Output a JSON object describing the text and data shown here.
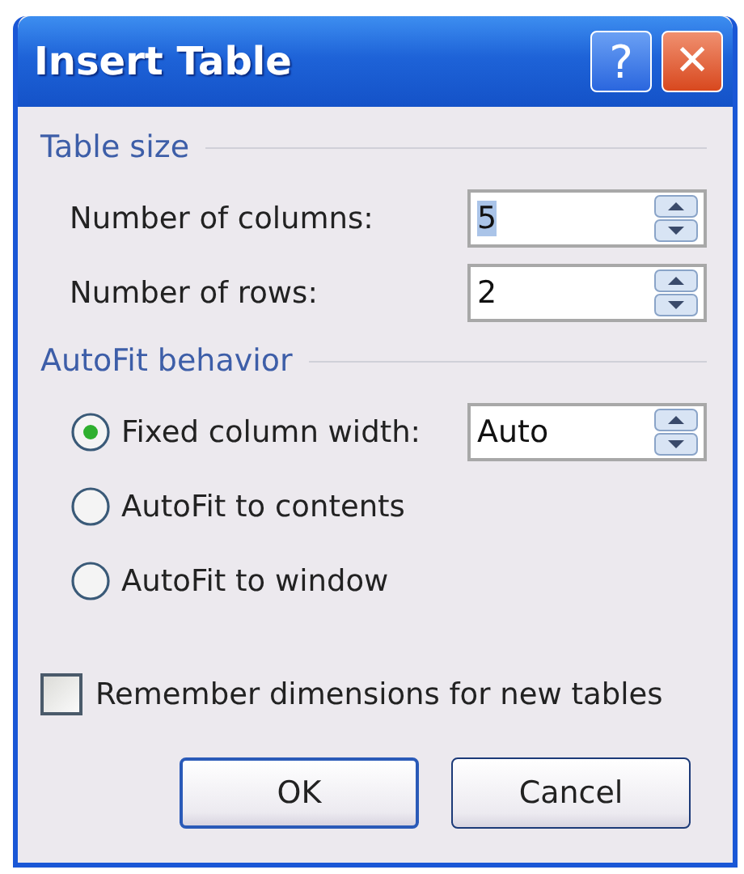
{
  "window": {
    "title": "Insert Table"
  },
  "title_buttons": [
    {
      "kind": "help",
      "label": "?"
    },
    {
      "kind": "close",
      "label": "✕"
    }
  ],
  "table_size": {
    "heading": "Table size",
    "fields": [
      {
        "label": "Number of columns:",
        "value": "5",
        "text_selected": true
      },
      {
        "label": "Number of rows:",
        "value": "2",
        "text_selected": false
      }
    ]
  },
  "autofit": {
    "heading": "AutoFit behavior",
    "options": [
      {
        "label": "Fixed column width:",
        "selected": true,
        "field_value": "Auto"
      },
      {
        "label": "AutoFit to contents",
        "selected": false
      },
      {
        "label": "AutoFit to window",
        "selected": false
      }
    ]
  },
  "remember": {
    "label": "Remember dimensions for new tables",
    "checked": false
  },
  "buttons": [
    {
      "label": "OK",
      "default": true
    },
    {
      "label": "Cancel",
      "default": false
    }
  ]
}
